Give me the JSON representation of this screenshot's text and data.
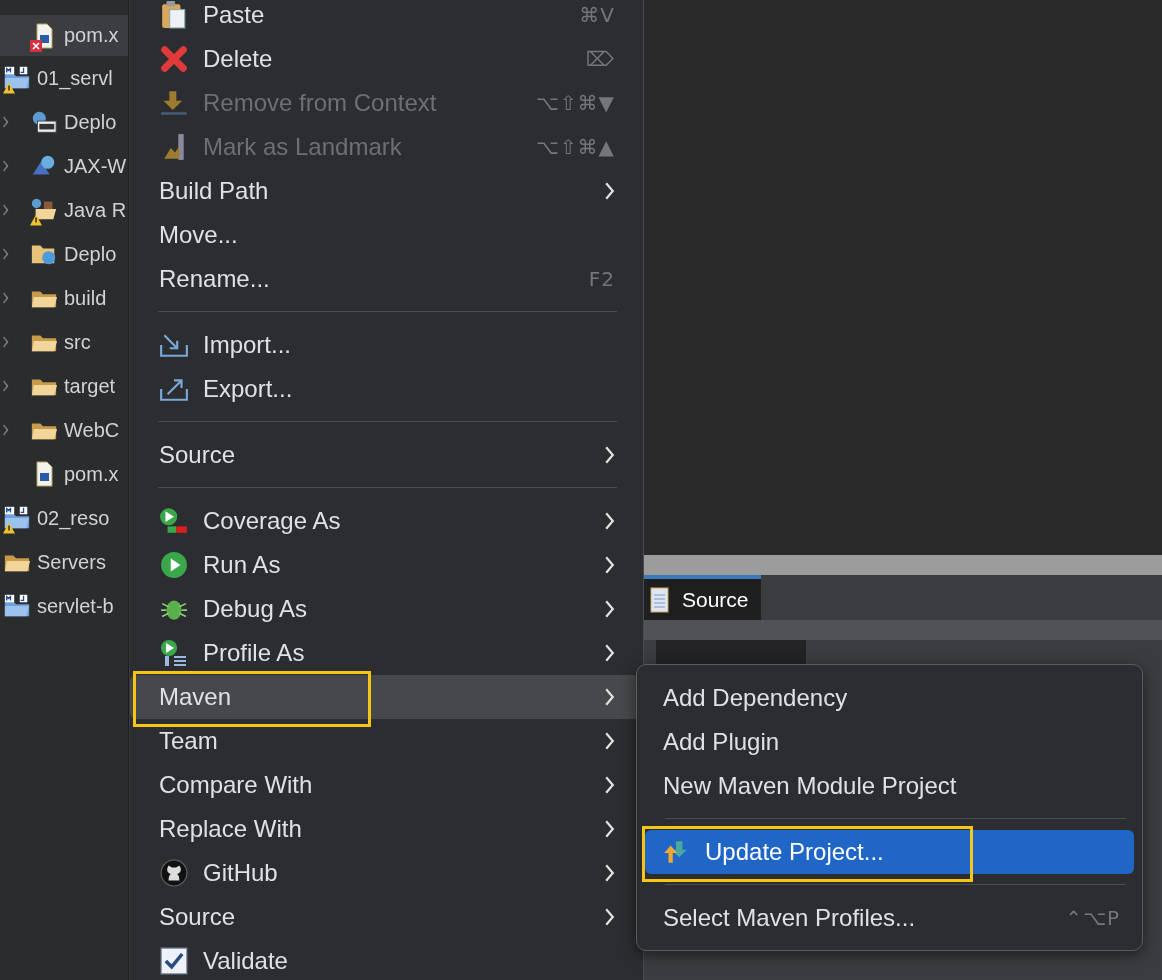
{
  "tree": [
    {
      "children": [
        {
          "label": "pom.x",
          "kind": "file",
          "selected": true,
          "error": true,
          "warning": false
        }
      ]
    },
    {
      "label": "01_servl",
      "kind": "project",
      "selected": false,
      "warning": true,
      "error": false,
      "children": [
        {
          "label": "Deplo",
          "kind": "deployment",
          "expanded": false,
          "selected": false,
          "warning": false,
          "error": false
        },
        {
          "label": "JAX-W",
          "kind": "webservice",
          "expanded": false,
          "selected": false,
          "warning": false,
          "error": false
        },
        {
          "label": "Java R",
          "kind": "resources",
          "expanded": false,
          "selected": false,
          "warning": true,
          "error": false
        },
        {
          "label": "Deplo",
          "kind": "deployed",
          "expanded": false,
          "selected": false,
          "warning": false,
          "error": false
        },
        {
          "label": "build",
          "kind": "folder",
          "expanded": false,
          "selected": false,
          "warning": false,
          "error": false
        },
        {
          "label": "src",
          "kind": "folder",
          "expanded": false,
          "selected": false,
          "warning": false,
          "error": false
        },
        {
          "label": "target",
          "kind": "folder",
          "expanded": false,
          "selected": false,
          "warning": false,
          "error": false
        },
        {
          "label": "WebC",
          "kind": "folder",
          "expanded": false,
          "selected": false,
          "warning": false,
          "error": false
        },
        {
          "label": "pom.x",
          "kind": "file",
          "selected": false,
          "warning": false,
          "error": false
        }
      ]
    },
    {
      "label": "02_reso",
      "kind": "project",
      "selected": false,
      "warning": true,
      "error": false
    },
    {
      "label": "Servers",
      "kind": "folder",
      "selected": false,
      "warning": false,
      "error": false
    },
    {
      "label": "servlet-b",
      "kind": "project",
      "selected": false,
      "warning": false,
      "error": false
    }
  ],
  "context_menu": [
    {
      "kind": "item",
      "label": "Paste",
      "shortcut": "⌘V",
      "disabled": false,
      "submenu": false,
      "selected": false,
      "highlighted": false
    },
    {
      "kind": "item",
      "label": "Delete",
      "shortcut": "⌦",
      "disabled": false,
      "submenu": false,
      "selected": false,
      "highlighted": false
    },
    {
      "kind": "item",
      "label": "Remove from Context",
      "shortcut": "⌥⇧⌘▼",
      "disabled": true,
      "submenu": false,
      "selected": false,
      "highlighted": false
    },
    {
      "kind": "item",
      "label": "Mark as Landmark",
      "shortcut": "⌥⇧⌘▲",
      "disabled": true,
      "submenu": false,
      "selected": false,
      "highlighted": false
    },
    {
      "kind": "item",
      "label": "Build Path",
      "disabled": false,
      "submenu": true,
      "selected": false,
      "highlighted": false
    },
    {
      "kind": "item",
      "label": "Move...",
      "disabled": false,
      "submenu": false,
      "selected": false,
      "highlighted": false
    },
    {
      "kind": "item",
      "label": "Rename...",
      "shortcut": "F2",
      "disabled": false,
      "submenu": false,
      "selected": false,
      "highlighted": false
    },
    {
      "kind": "separator"
    },
    {
      "kind": "item",
      "label": "Import...",
      "disabled": false,
      "submenu": false,
      "selected": false,
      "highlighted": false
    },
    {
      "kind": "item",
      "label": "Export...",
      "disabled": false,
      "submenu": false,
      "selected": false,
      "highlighted": false
    },
    {
      "kind": "separator"
    },
    {
      "kind": "item",
      "label": "Source",
      "disabled": false,
      "submenu": true,
      "selected": false,
      "highlighted": false
    },
    {
      "kind": "separator"
    },
    {
      "kind": "item",
      "label": "Coverage As",
      "disabled": false,
      "submenu": true,
      "selected": false,
      "highlighted": false
    },
    {
      "kind": "item",
      "label": "Run As",
      "disabled": false,
      "submenu": true,
      "selected": false,
      "highlighted": false
    },
    {
      "kind": "item",
      "label": "Debug As",
      "disabled": false,
      "submenu": true,
      "selected": false,
      "highlighted": false
    },
    {
      "kind": "item",
      "label": "Profile As",
      "disabled": false,
      "submenu": true,
      "selected": false,
      "highlighted": false
    },
    {
      "kind": "item",
      "label": "Maven",
      "disabled": false,
      "submenu": true,
      "selected": true,
      "highlighted": true
    },
    {
      "kind": "item",
      "label": "Team",
      "disabled": false,
      "submenu": true,
      "selected": false,
      "highlighted": false
    },
    {
      "kind": "item",
      "label": "Compare With",
      "disabled": false,
      "submenu": true,
      "selected": false,
      "highlighted": false
    },
    {
      "kind": "item",
      "label": "Replace With",
      "disabled": false,
      "submenu": true,
      "selected": false,
      "highlighted": false
    },
    {
      "kind": "item",
      "label": "GitHub",
      "disabled": false,
      "submenu": true,
      "selected": false,
      "highlighted": false
    },
    {
      "kind": "item",
      "label": "Source",
      "disabled": false,
      "submenu": true,
      "selected": false,
      "highlighted": false
    },
    {
      "kind": "item",
      "label": "Validate",
      "disabled": false,
      "submenu": false,
      "selected": false,
      "highlighted": false
    }
  ],
  "editor_tabs": [
    {
      "label": "Source",
      "selected": true
    }
  ],
  "maven_submenu": [
    {
      "kind": "item",
      "label": "Add Dependency",
      "selected": false,
      "highlighted": false
    },
    {
      "kind": "item",
      "label": "Add Plugin",
      "selected": false,
      "highlighted": false
    },
    {
      "kind": "item",
      "label": "New Maven Module Project",
      "selected": false,
      "highlighted": false
    },
    {
      "kind": "separator"
    },
    {
      "kind": "item",
      "label": "Update Project...",
      "selected": true,
      "highlighted": true
    },
    {
      "kind": "separator"
    },
    {
      "kind": "item",
      "label": "Select Maven Profiles...",
      "shortcut": "⌃⌥P",
      "selected": false,
      "highlighted": false
    }
  ]
}
